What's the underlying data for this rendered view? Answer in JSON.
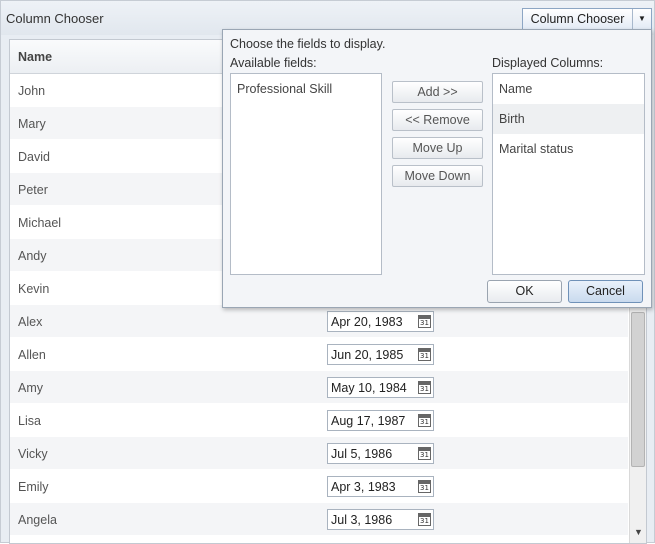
{
  "panel": {
    "title": "Column Chooser",
    "chooser_button": {
      "label": "Column Chooser",
      "arrow": "▼"
    }
  },
  "grid": {
    "columns": [
      "Name"
    ],
    "rows": [
      {
        "name": "John",
        "birth": ""
      },
      {
        "name": "Mary",
        "birth": ""
      },
      {
        "name": "David",
        "birth": ""
      },
      {
        "name": "Peter",
        "birth": ""
      },
      {
        "name": "Michael",
        "birth": ""
      },
      {
        "name": "Andy",
        "birth": ""
      },
      {
        "name": "Kevin",
        "birth": ""
      },
      {
        "name": "Alex",
        "birth": "Apr 20, 1983"
      },
      {
        "name": "Allen",
        "birth": "Jun 20, 1985"
      },
      {
        "name": "Amy",
        "birth": "May 10, 1984"
      },
      {
        "name": "Lisa",
        "birth": "Aug 17, 1987"
      },
      {
        "name": "Vicky",
        "birth": "Jul 5, 1986"
      },
      {
        "name": "Emily",
        "birth": "Apr 3, 1983"
      },
      {
        "name": "Angela",
        "birth": "Jul 3, 1986"
      }
    ],
    "scroll_arrow": "▼"
  },
  "dialog": {
    "instruction": "Choose the fields to display.",
    "available_label": "Available fields:",
    "displayed_label": "Displayed Columns:",
    "available_fields": [
      "Professional Skill"
    ],
    "displayed_columns": [
      "Name",
      "Birth",
      "Marital status"
    ],
    "buttons": {
      "add": "Add >>",
      "remove": "<< Remove",
      "move_up": "Move Up",
      "move_down": "Move Down",
      "ok": "OK",
      "cancel": "Cancel"
    }
  },
  "icons": {
    "calendar": "calendar-icon",
    "dropdown_arrow": "chevron-down-icon"
  },
  "colors": {
    "panel_bg": "#e8edf3",
    "grid_alt_row": "#f4f5f7",
    "dialog_bg": "#f3f5f8",
    "cancel_button": "#c9daee"
  }
}
